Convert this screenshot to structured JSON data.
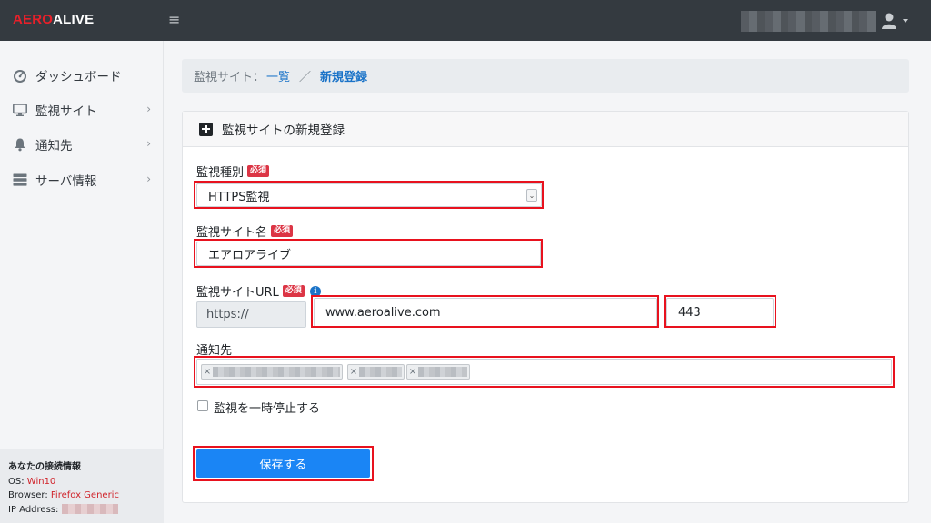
{
  "brand": {
    "part1": "AERO",
    "part2": "ALIVE"
  },
  "topbar": {
    "menu_glyph": "≡",
    "user_icon": "user-icon",
    "caret": "▾"
  },
  "sidebar": {
    "items": [
      {
        "label": "ダッシュボード",
        "icon": "dashboard-icon",
        "has_chevron": false
      },
      {
        "label": "監視サイト",
        "icon": "monitor-icon",
        "has_chevron": true
      },
      {
        "label": "通知先",
        "icon": "bell-icon",
        "has_chevron": true
      },
      {
        "label": "サーバ情報",
        "icon": "server-icon",
        "has_chevron": true
      }
    ],
    "chevron": "›",
    "connection": {
      "title": "あなたの接続情報",
      "os_label": "OS: ",
      "os_value": "Win10",
      "browser_label": "Browser: ",
      "browser_value": "Firefox Generic",
      "ip_label": "IP Address: "
    }
  },
  "breadcrumb": {
    "prefix": "監視サイト：",
    "link": "一覧",
    "separator": "／",
    "current": "新規登録"
  },
  "card": {
    "title": "監視サイトの新規登録",
    "required_badge": "必須",
    "type_label": "監視種別",
    "type_value": "HTTPS監視",
    "name_label": "監視サイト名",
    "name_value": "エアロアライブ",
    "url_label": "監視サイトURL",
    "info_glyph": "i",
    "url_prefix": "https://",
    "url_value": "www.aeroalive.com",
    "port_value": "443",
    "notify_label": "通知先",
    "tag_remove": "×",
    "pause_label": "監視を一時停止する",
    "pause_checked": false,
    "save_label": "保存する"
  },
  "colors": {
    "topbar": "#343a40",
    "brand_red": "#e8202a",
    "highlight": "#e8121e",
    "primary": "#1a85f5",
    "required": "#dc3545",
    "link": "#1a73c8"
  }
}
